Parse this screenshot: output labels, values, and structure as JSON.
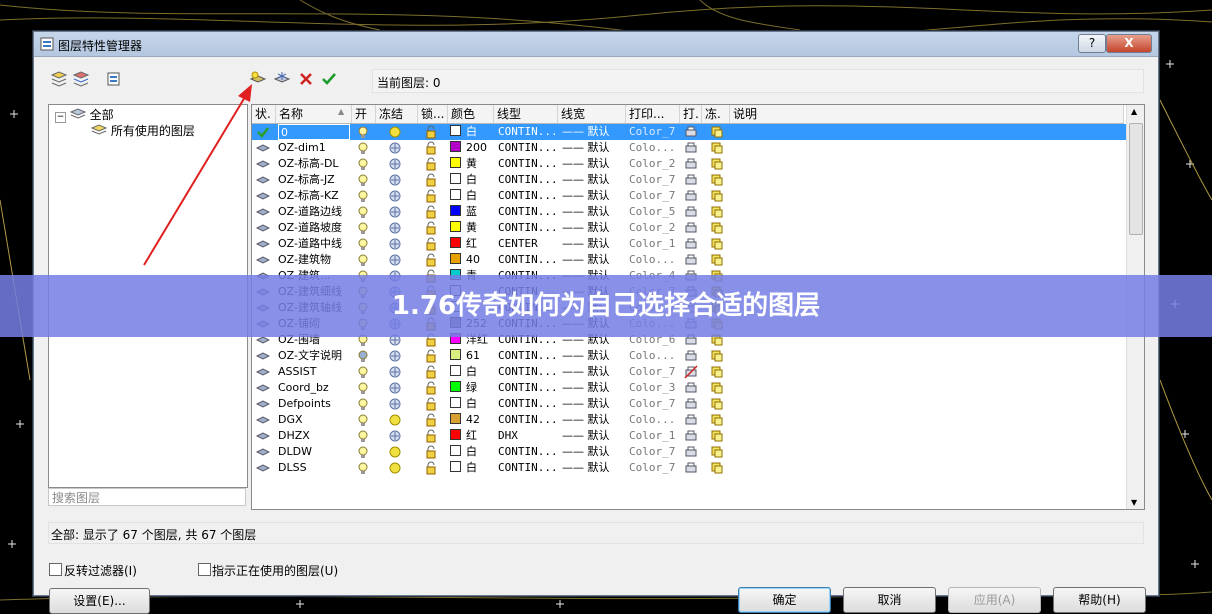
{
  "window": {
    "title": "图层特性管理器",
    "help_button": "?",
    "close_button": "X"
  },
  "toolbar": {
    "left_icons": [
      "new-filter-icon",
      "group-filter-icon",
      "state-manager-icon"
    ],
    "right_icons": [
      "new-layer-icon",
      "new-vp-frozen-layer-icon",
      "delete-layer-icon",
      "set-current-icon"
    ],
    "current_layer": "当前图层: 0"
  },
  "tree": {
    "root": "全部",
    "child": "所有使用的图层"
  },
  "search": {
    "placeholder": "搜索图层"
  },
  "columns": [
    "状.",
    "名称",
    "开",
    "冻结",
    "锁...",
    "颜色",
    "线型",
    "线宽",
    "打印...",
    "打.",
    "冻.",
    "说明"
  ],
  "layers": [
    {
      "name": "0",
      "color_name": "白",
      "color": "#ffffff",
      "linetype": "CONTIN...",
      "lineweight": "—— 默认",
      "plot": "Color_7",
      "on": true,
      "frozen": false,
      "current": true
    },
    {
      "name": "OZ-dim1",
      "color_name": "200",
      "color": "#b300c8",
      "linetype": "CONTIN...",
      "lineweight": "—— 默认",
      "plot": "Colo...",
      "on": true,
      "frozen": true
    },
    {
      "name": "OZ-标高-DL",
      "color_name": "黄",
      "color": "#ffff00",
      "linetype": "CONTIN...",
      "lineweight": "—— 默认",
      "plot": "Color_2",
      "on": true,
      "frozen": true
    },
    {
      "name": "OZ-标高-JZ",
      "color_name": "白",
      "color": "#ffffff",
      "linetype": "CONTIN...",
      "lineweight": "—— 默认",
      "plot": "Color_7",
      "on": true,
      "frozen": true
    },
    {
      "name": "OZ-标高-KZ",
      "color_name": "白",
      "color": "#ffffff",
      "linetype": "CONTIN...",
      "lineweight": "—— 默认",
      "plot": "Color_7",
      "on": true,
      "frozen": true
    },
    {
      "name": "OZ-道路边线",
      "color_name": "蓝",
      "color": "#0000ff",
      "linetype": "CONTIN...",
      "lineweight": "—— 默认",
      "plot": "Color_5",
      "on": true,
      "frozen": true
    },
    {
      "name": "OZ-道路坡度",
      "color_name": "黄",
      "color": "#ffff00",
      "linetype": "CONTIN...",
      "lineweight": "—— 默认",
      "plot": "Color_2",
      "on": true,
      "frozen": true
    },
    {
      "name": "OZ-道路中线",
      "color_name": "红",
      "color": "#ff0000",
      "linetype": "CENTER",
      "lineweight": "—— 默认",
      "plot": "Color_1",
      "on": true,
      "frozen": true
    },
    {
      "name": "OZ-建筑物",
      "color_name": "40",
      "color": "#e8a000",
      "linetype": "CONTIN...",
      "lineweight": "—— 默认",
      "plot": "Colo...",
      "on": true,
      "frozen": true
    },
    {
      "name": "OZ-建筑...",
      "color_name": "青",
      "color": "#00cccc",
      "linetype": "CONTIN...",
      "lineweight": "—— 默认",
      "plot": "Color_4",
      "on": true,
      "frozen": true
    },
    {
      "name": "OZ-建筑细线",
      "color_name": "",
      "color": "#ffffff",
      "linetype": "CONTIN...",
      "lineweight": "—— 默认",
      "plot": "Color_7",
      "on": true,
      "frozen": true
    },
    {
      "name": "OZ-建筑轴线",
      "color_name": "",
      "color": "#ffffff",
      "linetype": "CONTIN...",
      "lineweight": "—— 默认",
      "plot": "Color_7",
      "on": true,
      "frozen": true
    },
    {
      "name": "OZ-铺砌",
      "color_name": "252",
      "color": "#808080",
      "linetype": "CONTIN...",
      "lineweight": "—— 默认",
      "plot": "Colo...",
      "on": true,
      "frozen": true
    },
    {
      "name": "OZ-围墙",
      "color_name": "洋红",
      "color": "#ff00ff",
      "linetype": "CONTIN...",
      "lineweight": "—— 默认",
      "plot": "Color_6",
      "on": true,
      "frozen": true
    },
    {
      "name": "OZ-文字说明",
      "color_name": "61",
      "color": "#d8f080",
      "linetype": "CONTIN...",
      "lineweight": "—— 默认",
      "plot": "Colo...",
      "on": false,
      "frozen": true
    },
    {
      "name": "ASSIST",
      "color_name": "白",
      "color": "#ffffff",
      "linetype": "CONTIN...",
      "lineweight": "—— 默认",
      "plot": "Color_7",
      "on": true,
      "frozen": true,
      "noplot": true
    },
    {
      "name": "Coord_bz",
      "color_name": "绿",
      "color": "#00ff00",
      "linetype": "CONTIN...",
      "lineweight": "—— 默认",
      "plot": "Color_3",
      "on": true,
      "frozen": true
    },
    {
      "name": "Defpoints",
      "color_name": "白",
      "color": "#ffffff",
      "linetype": "CONTIN...",
      "lineweight": "—— 默认",
      "plot": "Color_7",
      "on": true,
      "frozen": true
    },
    {
      "name": "DGX",
      "color_name": "42",
      "color": "#d8a030",
      "linetype": "CONTIN...",
      "lineweight": "—— 默认",
      "plot": "Colo...",
      "on": true,
      "frozen": false
    },
    {
      "name": "DHZX",
      "color_name": "红",
      "color": "#ff0000",
      "linetype": "DHX",
      "lineweight": "—— 默认",
      "plot": "Color_1",
      "on": true,
      "frozen": true
    },
    {
      "name": "DLDW",
      "color_name": "白",
      "color": "#ffffff",
      "linetype": "CONTIN...",
      "lineweight": "—— 默认",
      "plot": "Color_7",
      "on": true,
      "frozen": false
    },
    {
      "name": "DLSS",
      "color_name": "白",
      "color": "#ffffff",
      "linetype": "CONTIN...",
      "lineweight": "—— 默认",
      "plot": "Color_7",
      "on": true,
      "frozen": false
    }
  ],
  "status": "全部: 显示了 67 个图层, 共 67 个图层",
  "options": {
    "invert_filter": "反转过滤器(I)",
    "indicate_in_use": "指示正在使用的图层(U)"
  },
  "buttons": {
    "settings": "设置(E)...",
    "ok": "确定",
    "cancel": "取消",
    "apply": "应用(A)",
    "help": "帮助(H)"
  },
  "banner": "1.76传奇如何为自己选择合适的图层",
  "colors": {
    "selection": "#3399ff",
    "banner": "#747ee4",
    "arrow": "#e02020"
  }
}
